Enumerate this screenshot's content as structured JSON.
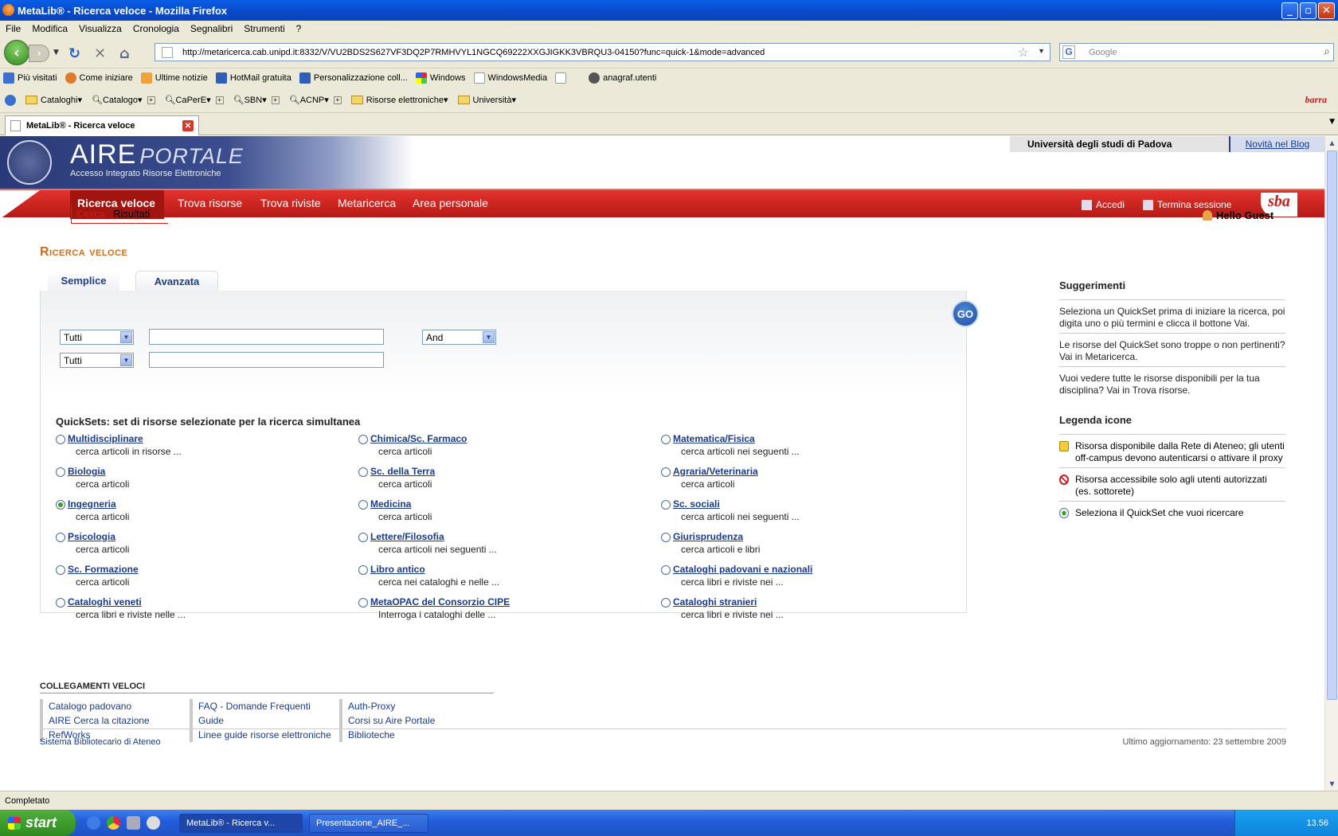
{
  "window": {
    "title": "MetaLib® - Ricerca veloce - Mozilla Firefox"
  },
  "menu": [
    "File",
    "Modifica",
    "Visualizza",
    "Cronologia",
    "Segnalibri",
    "Strumenti",
    "?"
  ],
  "address": {
    "url": "http://metaricerca.cab.unipd.it:8332/V/VU2BDS2S627VF3DQ2P7RMHVYL1NGCQ69222XXGJIGKK3VBRQU3-04150?func=quick-1&mode=advanced"
  },
  "search": {
    "placeholder": "Google"
  },
  "bookmarks": [
    "Più visitati",
    "Come iniziare",
    "Ultime notizie",
    "HotMail gratuita",
    "Personalizzazione coll...",
    "Windows",
    "WindowsMedia",
    "",
    "anagraf.utenti"
  ],
  "toolbar2": [
    "Cataloghi",
    "Catalogo",
    "CaPerE",
    "SBN",
    "ACNP",
    "Risorse elettroniche",
    "Università"
  ],
  "toolbar2_brand": "barra",
  "tab": {
    "label": "MetaLib® - Ricerca veloce"
  },
  "site": {
    "brand": "AIRE",
    "brand_suffix": "PORTALE",
    "tagline": "Accesso Integrato Risorse Elettroniche",
    "university": "Università degli studi di Padova",
    "blog_link": "Novità nel Blog",
    "nav": [
      "Ricerca veloce",
      "Trova risorse",
      "Trova riviste",
      "Metaricerca",
      "Area personale"
    ],
    "login": "Accedi",
    "logout": "Termina sessione",
    "logo": "sba",
    "subtabs": [
      "Cerca",
      "Risultati"
    ],
    "greeting": "Hello Guest",
    "page_title": "Ricerca veloce"
  },
  "search_form": {
    "tabs": [
      "Semplice",
      "Avanzata"
    ],
    "field1": "Tutti",
    "field2": "Tutti",
    "operator": "And",
    "go": "GO"
  },
  "quicksets": {
    "title": "QuickSets: set di risorse selezionate per la ricerca simultanea",
    "items": [
      {
        "name": "Multidisciplinare",
        "desc": "cerca articoli in risorse ..."
      },
      {
        "name": "Chimica/Sc. Farmaco",
        "desc": "cerca articoli"
      },
      {
        "name": "Matematica/Fisica",
        "desc": "cerca articoli nei seguenti ..."
      },
      {
        "name": "Biologia",
        "desc": "cerca articoli"
      },
      {
        "name": "Sc. della Terra",
        "desc": "cerca articoli"
      },
      {
        "name": "Agraria/Veterinaria",
        "desc": "cerca articoli"
      },
      {
        "name": "Ingegneria",
        "desc": "cerca articoli",
        "selected": true
      },
      {
        "name": "Medicina",
        "desc": "cerca articoli"
      },
      {
        "name": "Sc. sociali",
        "desc": "cerca articoli nei seguenti ..."
      },
      {
        "name": "Psicologia",
        "desc": "cerca articoli"
      },
      {
        "name": "Lettere/Filosofia",
        "desc": "cerca articoli nei seguenti ..."
      },
      {
        "name": "Giurisprudenza",
        "desc": "cerca articoli e libri"
      },
      {
        "name": "Sc. Formazione",
        "desc": "cerca articoli"
      },
      {
        "name": "Libro antico",
        "desc": "cerca nei cataloghi e nelle ..."
      },
      {
        "name": "Cataloghi padovani e nazionali",
        "desc": "cerca libri e riviste nei ..."
      },
      {
        "name": "Cataloghi veneti",
        "desc": "cerca libri e riviste nelle ..."
      },
      {
        "name": "MetaOPAC del Consorzio CIPE",
        "desc": "Interroga i cataloghi delle ..."
      },
      {
        "name": "Cataloghi stranieri",
        "desc": "cerca libri e riviste nei ..."
      }
    ]
  },
  "sidebar": {
    "tips_title": "Suggerimenti",
    "tips": [
      "Seleziona un QuickSet prima di iniziare la ricerca, poi digita uno o più termini e clicca il bottone Vai.",
      "Le risorse del QuickSet sono troppe o non pertinenti? Vai in Metaricerca.",
      "Vuoi vedere tutte le risorse disponibili per la tua disciplina? Vai in Trova risorse."
    ],
    "legend_title": "Legenda icone",
    "legend": [
      {
        "icon": "lock-icon",
        "text": "Risorsa disponibile dalla Rete di Ateneo; gli utenti off-campus devono autenticarsi o attivare il proxy"
      },
      {
        "icon": "restricted-icon",
        "text": "Risorsa accessibile solo agli utenti autorizzati (es. sottorete)"
      },
      {
        "icon": "radio-selected-icon",
        "text": "Seleziona il QuickSet che vuoi ricercare"
      }
    ]
  },
  "quick_links": {
    "title": "COLLEGAMENTI VELOCI",
    "col1": [
      "Catalogo padovano",
      "AIRE Cerca la citazione",
      "RefWorks"
    ],
    "col2": [
      "FAQ - Domande Frequenti",
      "Guide",
      "Linee guide risorse elettroniche"
    ],
    "col3": [
      "Auth-Proxy",
      "Corsi su Aire Portale",
      "Biblioteche"
    ]
  },
  "footer": {
    "left": "Sistema Bibliotecario di Ateneo",
    "right": "Ultimo aggiornamento: 23 settembre 2009"
  },
  "status": "Completato",
  "taskbar": {
    "start": "start",
    "tasks": [
      "MetaLib® - Ricerca v...",
      "Presentazione_AIRE_..."
    ],
    "clock": "13.56"
  }
}
